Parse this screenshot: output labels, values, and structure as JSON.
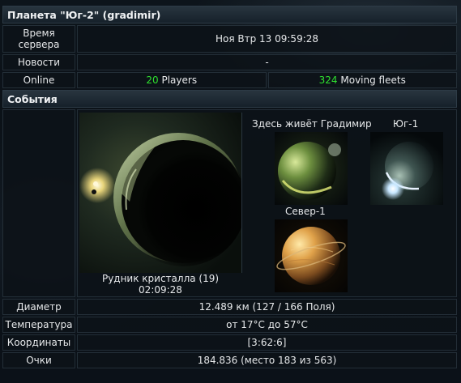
{
  "header": {
    "title": "Планета \"Юг-2\" (gradimir)"
  },
  "rows": {
    "server_time": {
      "label": "Время сервера",
      "value": "Ноя Втр 13 09:59:28"
    },
    "news": {
      "label": "Новости",
      "value": "-"
    },
    "online": {
      "label": "Online",
      "players_count": "20",
      "players_text": " Players",
      "fleets_count": "324",
      "fleets_text": " Moving fleets"
    }
  },
  "events": {
    "title": "События"
  },
  "planet": {
    "name": "Рудник кристалла (19)",
    "timer": "02:09:28",
    "image_icon": "planet-crystal-mine-icon"
  },
  "moons": [
    {
      "label": "Здесь живёт Градимир",
      "icon": "planet-home-icon"
    },
    {
      "label": "Юг-1",
      "icon": "planet-south1-icon"
    },
    {
      "label": "Север-1",
      "icon": "planet-north1-icon"
    }
  ],
  "stats": {
    "diameter": {
      "label": "Диаметр",
      "value": "12.489 км (127 / 166 Поля)"
    },
    "temperature": {
      "label": "Температура",
      "value": "от 17°C до 57°C"
    },
    "coordinates": {
      "label": "Координаты",
      "value": "[3:62:6]"
    },
    "points": {
      "label": "Очки",
      "value": "184.836 (место 183 из 563)"
    }
  },
  "colors": {
    "accent_green": "#2fe02f",
    "header_bg": "#1e2a34"
  }
}
